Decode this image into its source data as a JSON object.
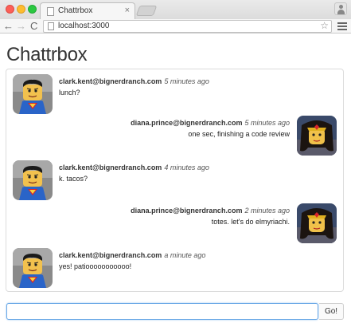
{
  "browser": {
    "tab_title": "Chattrbox",
    "tab_close_glyph": "×",
    "url": "localhost:3000",
    "back_glyph": "←",
    "forward_glyph": "→",
    "reload_glyph": "C",
    "star_glyph": "☆"
  },
  "page": {
    "title": "Chattrbox"
  },
  "messages": [
    {
      "sender": "clark.kent@bignerdranch.com",
      "time": "5 minutes ago",
      "text": "lunch?",
      "side": "left",
      "avatar": "superman-avatar"
    },
    {
      "sender": "diana.prince@bignerdranch.com",
      "time": "5 minutes ago",
      "text": "one sec, finishing a code review",
      "side": "right",
      "avatar": "wonder-woman-avatar"
    },
    {
      "sender": "clark.kent@bignerdranch.com",
      "time": "4 minutes ago",
      "text": "k. tacos?",
      "side": "left",
      "avatar": "superman-avatar"
    },
    {
      "sender": "diana.prince@bignerdranch.com",
      "time": "2 minutes ago",
      "text": "totes. let's do elmyriachi.",
      "side": "right",
      "avatar": "wonder-woman-avatar"
    },
    {
      "sender": "clark.kent@bignerdranch.com",
      "time": "a minute ago",
      "text": "yes! patiooooooooooo!",
      "side": "left",
      "avatar": "superman-avatar"
    }
  ],
  "composer": {
    "value": "",
    "send_label": "Go!"
  },
  "colors": {
    "input_focus": "#6aa8e6",
    "superman_blue": "#2a64c8",
    "superman_red": "#d8232a",
    "wonder_woman_gold": "#e0b020"
  }
}
